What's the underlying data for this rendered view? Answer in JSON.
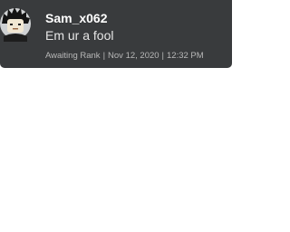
{
  "comment": {
    "username": "Sam_x062",
    "message": "Em ur a fool",
    "rank": "Awaiting Rank",
    "date": "Nov 12, 2020",
    "time": "12:32 PM",
    "separator": "|",
    "avatar_icon": "user-avatar-headshot"
  },
  "colors": {
    "card_background": "#393b3d",
    "username": "#ffffff",
    "message": "#e6e6e6",
    "meta": "#b8b8b8",
    "page_background": "#ffffff"
  }
}
